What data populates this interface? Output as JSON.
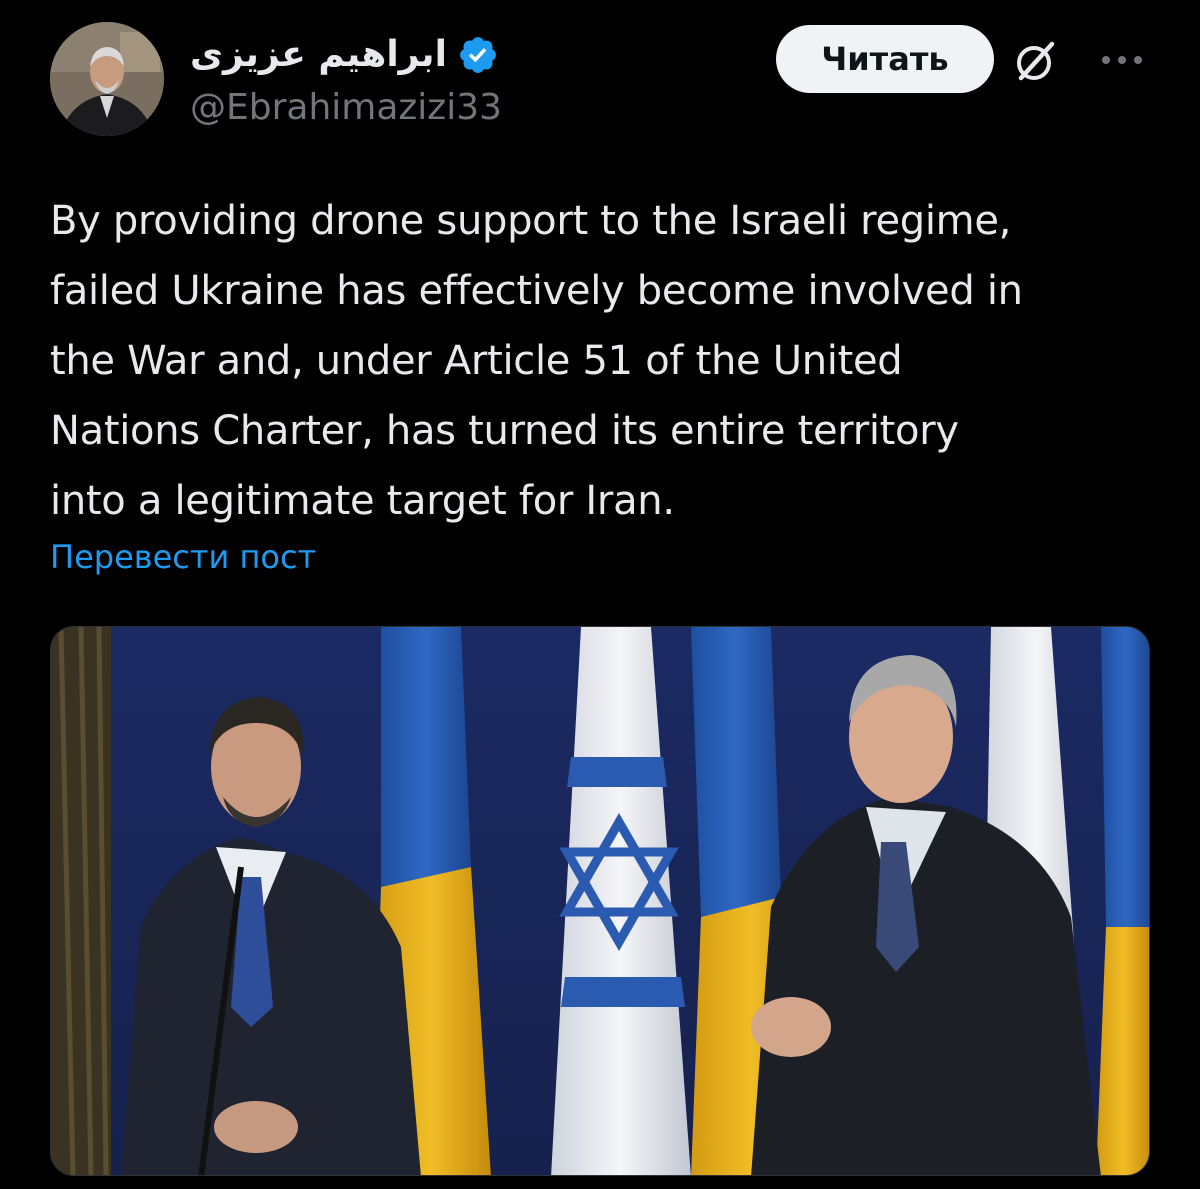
{
  "post": {
    "author": {
      "display_name": "ابراهیم عزیزی",
      "handle": "@Ebrahimazizi33",
      "verified": true,
      "avatar": "author-avatar-photo"
    },
    "actions": {
      "read_label": "Читать",
      "grok_icon": "grok-slash-circle-icon",
      "more_icon": "more-dots-icon"
    },
    "text_lines": [
      "By providing drone support to the Israeli regime,",
      "failed Ukraine has effectively become involved in",
      "the War and, under Article 51 of the United",
      "Nations Charter, has turned its entire territory",
      "into a legitimate target for Iran."
    ],
    "translate_label": "Перевести пост",
    "media": {
      "type": "photo",
      "flags": [
        "israel-flag",
        "ukraine-flag"
      ]
    }
  },
  "colors": {
    "background": "#000000",
    "text": "#e7e9ea",
    "secondary_text": "#71767b",
    "link": "#1d9bf0",
    "verified_badge": "#1d9bf0",
    "read_button_bg": "#eff3f4"
  }
}
